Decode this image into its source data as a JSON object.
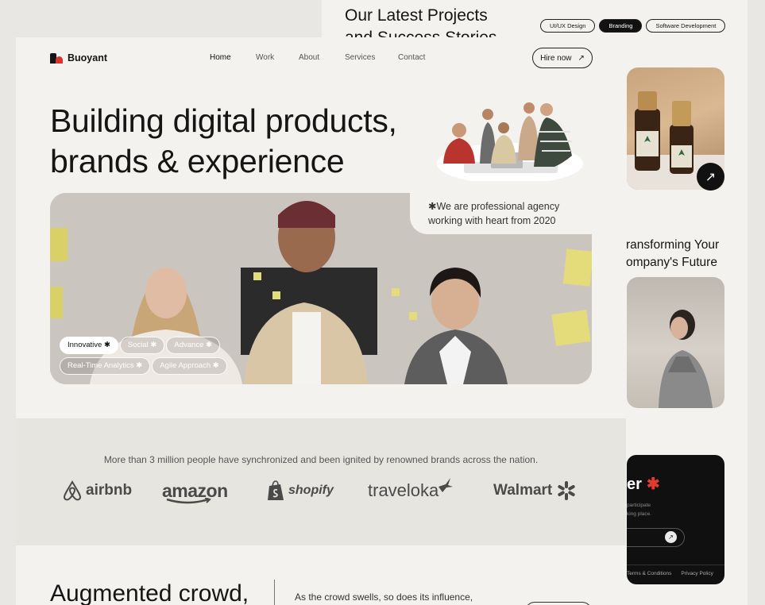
{
  "back_page": {
    "title": "Our Latest Projects\nand Success Stories",
    "filters": [
      {
        "label": "UI/UX Design",
        "active": false
      },
      {
        "label": "Branding",
        "active": true
      },
      {
        "label": "Software Development",
        "active": false
      }
    ],
    "transform_text": "ransforming Your\nompany's Future",
    "footer_card": {
      "heading": "er",
      "star": "✱",
      "line1": "participate",
      "line2": "king place.",
      "links": [
        "Terms & Conditions",
        "Privacy Policy"
      ]
    }
  },
  "header": {
    "brand": "Buoyant",
    "nav": [
      "Home",
      "Work",
      "About",
      "Services",
      "Contact"
    ],
    "active_nav": "Home",
    "hire_label": "Hire now",
    "hire_arrow": "↗"
  },
  "hero": {
    "title": "Building digital products,\nbrands & experience",
    "agency_text": "✱We are professional agency\nworking with heart from 2020",
    "tags_row1": [
      "Innovative ✱",
      "Social ✱",
      "Advance ✱"
    ],
    "tags_row2": [
      "Real-Time Analytics ✱",
      "Agile Approach ✱"
    ],
    "active_tag": "Innovative ✱"
  },
  "brands": {
    "caption": "More than 3 million people have synchronized and been ignited by renowned brands across the nation.",
    "logos": [
      "airbnb",
      "amazon",
      "shopify",
      "traveloka",
      "Walmart"
    ]
  },
  "section2": {
    "title": "Augmented crowd,",
    "text": "As the crowd swells, so does its influence,"
  },
  "colors": {
    "accent_red": "#d9362b",
    "dark": "#111111",
    "page_bg": "#f3f2ee",
    "band_bg": "#e6e5e0"
  }
}
